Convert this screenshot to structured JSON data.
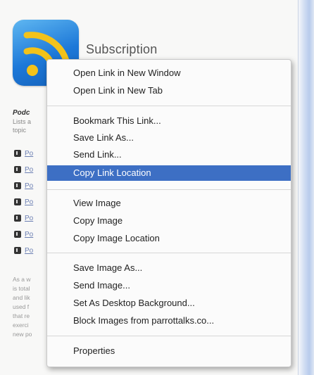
{
  "page": {
    "title": "Subscription",
    "side_heading": "Podc",
    "side_desc_line1": "Lists a",
    "side_desc_line2": "topic",
    "links": [
      "Po",
      "Po",
      "Po",
      "Po",
      "Po",
      "Po",
      "Po"
    ],
    "paragraph": [
      "As a w",
      "is total",
      "and lik",
      "used f",
      "that re",
      "exerci",
      "new po"
    ]
  },
  "context_menu": {
    "items": [
      {
        "label": "Open Link in New Window"
      },
      {
        "label": "Open Link in New Tab"
      },
      {
        "label": "Bookmark This Link..."
      },
      {
        "label": "Save Link As..."
      },
      {
        "label": "Send Link..."
      },
      {
        "label": "Copy Link Location",
        "highlighted": true
      },
      {
        "label": "View Image"
      },
      {
        "label": "Copy Image"
      },
      {
        "label": "Copy Image Location"
      },
      {
        "label": "Save Image As..."
      },
      {
        "label": "Send Image..."
      },
      {
        "label": "Set As Desktop Background..."
      },
      {
        "label": "Block Images from parrottalks.co..."
      },
      {
        "label": "Properties"
      }
    ]
  },
  "colors": {
    "highlight": "#3d6fc4",
    "rss_icon": "#1d78d8",
    "rss_waves": "#f3c21a"
  },
  "icons": {
    "feed": "rss-feed-icon",
    "link": "podcast-link-icon"
  }
}
